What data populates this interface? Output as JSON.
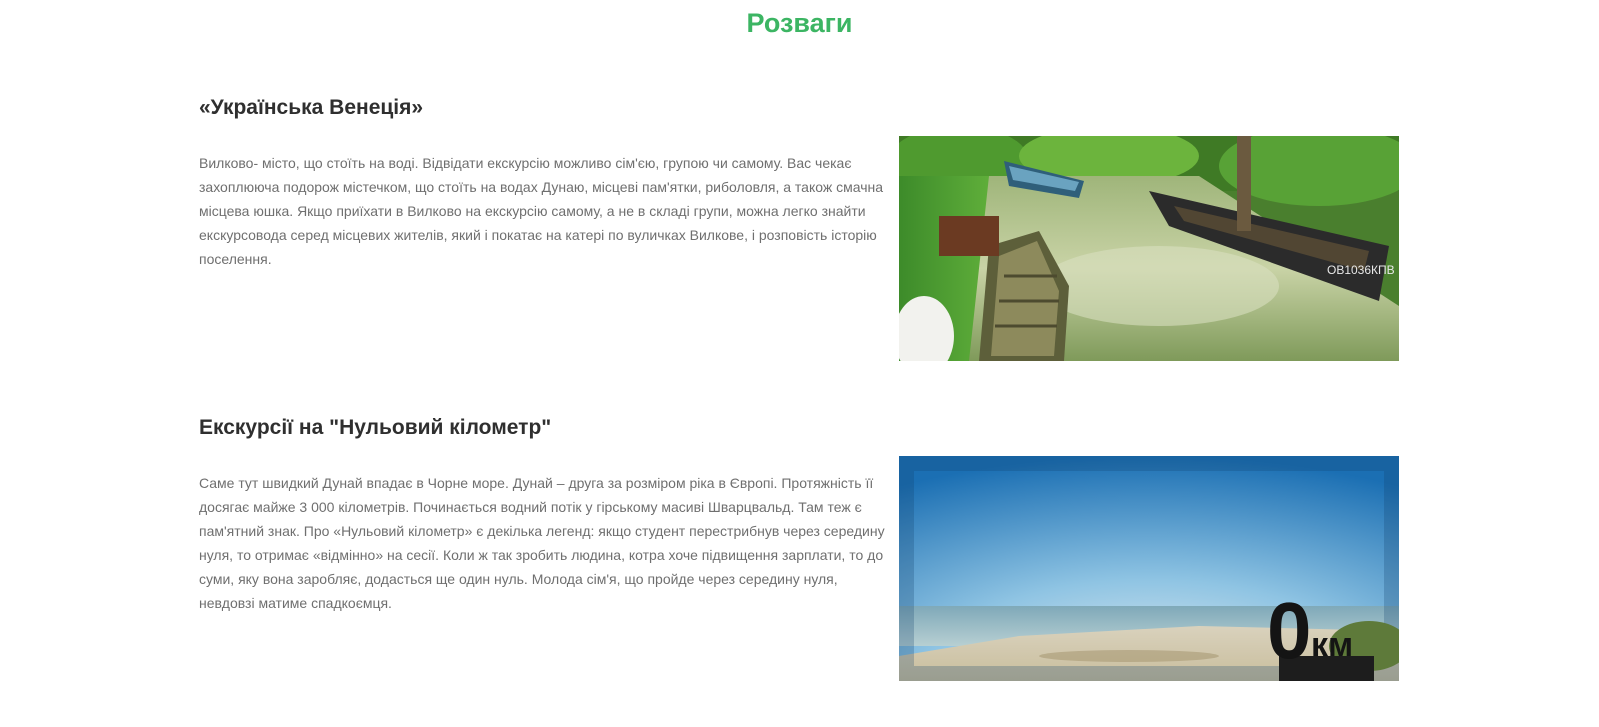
{
  "page": {
    "title": "Розваги"
  },
  "sections": [
    {
      "title": "«Українська Венеція»",
      "text": "Вилково- місто, що стоїть на воді. Відвідати екскурсію можливо сім'єю, групою чи самому. Вас чекає захоплююча подорож містечком, що стоїть на водах Дунаю, місцеві пам'ятки, риболовля, а також смачна місцева юшка. Якщо приїхати в Вилково на екскурсію самому, а не в складі групи, можна легко знайти екскурсовода серед місцевих жителів, який і покатає на катері по вуличках Вилкове, і розповість історію поселення.",
      "image_boat_label": "ОВ1036КПВ"
    },
    {
      "title": "Екскурсії на \"Нульовий кілометр\"",
      "text": "Саме тут швидкий Дунай впадає в Чорне море. Дунай – друга за розміром ріка в Європі. Протяжність її досягає майже 3 000 кілометрів. Починається водний потік у гірському масиві Шварцвальд. Там теж є пам'ятний знак. Про «Нульовий кілометр» є декілька легенд: якщо студент перестрибнув через середину нуля, то отримає «відмінно» на сесії. Коли ж так зробить людина, котра хоче підвищення зарплати, то до суми, яку вона заробляє, додасться ще один нуль. Молода сім'я, що пройде через середину нуля, невдовзі матиме спадкоємця.",
      "image_sign_digit": "0",
      "image_sign_unit": "км"
    }
  ],
  "colors": {
    "title_accent": "#3cb563",
    "heading": "#2f2f2f",
    "body_text": "#6f6f6f"
  }
}
